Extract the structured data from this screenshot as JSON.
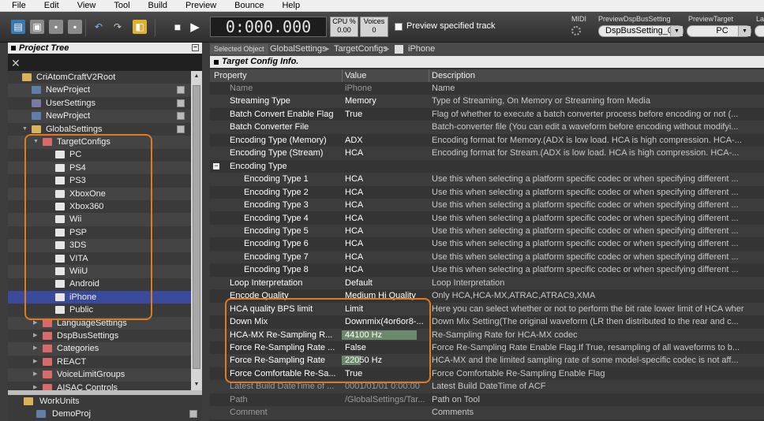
{
  "menu": [
    "File",
    "Edit",
    "View",
    "Tool",
    "Build",
    "Preview",
    "Bounce",
    "Help"
  ],
  "toolbar": {
    "timecode": "0:000.000",
    "cpu_label": "CPU %",
    "cpu_value": "0.00",
    "voices_label": "Voices",
    "voices_value": "0",
    "preview_track_label": "Preview specified track",
    "midi_label": "MIDI",
    "dspbus_label": "PreviewDspBusSetting",
    "dspbus_value": "DspBusSetting_0",
    "target_label": "PreviewTarget",
    "target_value": "PC",
    "la_label": "La"
  },
  "project_tree": {
    "title": "Project Tree",
    "items": [
      {
        "label": "CriAtomCraftV2Root",
        "icon": "folder-icon"
      },
      {
        "label": "NewProject",
        "icon": "project-icon"
      },
      {
        "label": "UserSettings",
        "icon": "settings-icon"
      },
      {
        "label": "NewProject",
        "icon": "project-icon"
      },
      {
        "label": "GlobalSettings",
        "icon": "folder-icon"
      },
      {
        "label": "TargetConfigs",
        "icon": "folder-icon"
      },
      {
        "label": "PC",
        "icon": "target-icon"
      },
      {
        "label": "PS4",
        "icon": "target-icon"
      },
      {
        "label": "PS3",
        "icon": "target-icon"
      },
      {
        "label": "XboxOne",
        "icon": "target-icon"
      },
      {
        "label": "Xbox360",
        "icon": "target-icon"
      },
      {
        "label": "Wii",
        "icon": "target-icon"
      },
      {
        "label": "PSP",
        "icon": "target-icon"
      },
      {
        "label": "3DS",
        "icon": "target-icon"
      },
      {
        "label": "VITA",
        "icon": "target-icon"
      },
      {
        "label": "WiiU",
        "icon": "target-icon"
      },
      {
        "label": "Android",
        "icon": "target-icon"
      },
      {
        "label": "iPhone",
        "icon": "target-icon"
      },
      {
        "label": "Public",
        "icon": "target-icon"
      },
      {
        "label": "LanguageSettings",
        "icon": "folder-icon"
      },
      {
        "label": "DspBusSettings",
        "icon": "folder-icon"
      },
      {
        "label": "Categories",
        "icon": "folder-icon"
      },
      {
        "label": "REACT",
        "icon": "folder-icon"
      },
      {
        "label": "VoiceLimitGroups",
        "icon": "folder-icon"
      },
      {
        "label": "AISAC Controls",
        "icon": "folder-icon"
      }
    ],
    "work_units": "WorkUnits",
    "demo_proj": "DemoProj"
  },
  "breadcrumb": {
    "selected_object": "Selected Object",
    "items": [
      "GlobalSettings",
      "TargetConfigs",
      "iPhone"
    ]
  },
  "target_config": {
    "title": "Target Config Info.",
    "columns": [
      "Property",
      "Value",
      "Description"
    ],
    "rows": [
      {
        "p": "Name",
        "v": "iPhone",
        "d": "Name"
      },
      {
        "p": "Streaming Type",
        "v": "Memory",
        "d": "Type of Streaming, On Memory or Streaming from Media"
      },
      {
        "p": "Batch Convert Enable Flag",
        "v": "True",
        "d": "Flag of whether to execute a batch converter process before encoding or not (..."
      },
      {
        "p": "Batch Converter File",
        "v": "",
        "d": "Batch-converter file (You can edit a waveform before encoding without modifyi..."
      },
      {
        "p": "Encoding Type (Memory)",
        "v": "ADX",
        "d": "Encoding format for Memory.(ADX is low load. HCA is high compression. HCA-..."
      },
      {
        "p": "Encoding Type (Stream)",
        "v": "HCA",
        "d": "Encoding format for Stream.(ADX is low load. HCA is high compression. HCA-..."
      },
      {
        "p": "Encoding Type",
        "v": "",
        "d": ""
      },
      {
        "p": "Encoding Type 1",
        "v": "HCA",
        "d": "Use this when selecting a platform specific codec or when specifying different ..."
      },
      {
        "p": "Encoding Type 2",
        "v": "HCA",
        "d": "Use this when selecting a platform specific codec or when specifying different ..."
      },
      {
        "p": "Encoding Type 3",
        "v": "HCA",
        "d": "Use this when selecting a platform specific codec or when specifying different ..."
      },
      {
        "p": "Encoding Type 4",
        "v": "HCA",
        "d": "Use this when selecting a platform specific codec or when specifying different ..."
      },
      {
        "p": "Encoding Type 5",
        "v": "HCA",
        "d": "Use this when selecting a platform specific codec or when specifying different ..."
      },
      {
        "p": "Encoding Type 6",
        "v": "HCA",
        "d": "Use this when selecting a platform specific codec or when specifying different ..."
      },
      {
        "p": "Encoding Type 7",
        "v": "HCA",
        "d": "Use this when selecting a platform specific codec or when specifying different ..."
      },
      {
        "p": "Encoding Type 8",
        "v": "HCA",
        "d": "Use this when selecting a platform specific codec or when specifying different ..."
      },
      {
        "p": "Loop Interpretation",
        "v": "Default",
        "d": "Loop Interpretation"
      },
      {
        "p": "Encode Quality",
        "v": "Medium Hi Quality",
        "d": "Only HCA,HCA-MX,ATRAC,ATRAC9,XMA"
      },
      {
        "p": "HCA quality BPS limit",
        "v": "Limit",
        "d": "Here you can select whether or not to perform the bit rate lower limit of HCA wher"
      },
      {
        "p": "Down Mix",
        "v": "Downmix(4or6or8-...",
        "d": "Down Mix Setting(The original waveform (LR then distributed to the rear and c..."
      },
      {
        "p": "HCA-MX Re-Sampling R...",
        "v": "44100 Hz",
        "d": "Re-Sampling Rate for HCA-MX codec"
      },
      {
        "p": "Force Re-Sampling Rate ...",
        "v": "False",
        "d": "Force Re-Sampling Rate Enable Flag.If True, resampling of all waveforms to b..."
      },
      {
        "p": "Force Re-Sampling Rate",
        "v": "22050 Hz",
        "d": "HCA-MX and the limited sampling rate of some model-specific codec is not aff..."
      },
      {
        "p": "Force Comfortable Re-Sa...",
        "v": "True",
        "d": "Force Comfortable Re-Sampling Enable Flag"
      },
      {
        "p": "Latest Build DateTime of ...",
        "v": "0001/01/01 0:00:00",
        "d": "Latest Build DateTime of ACF"
      },
      {
        "p": "Path",
        "v": "/GlobalSettings/Tar...",
        "d": "Path on Tool"
      },
      {
        "p": "Comment",
        "v": "",
        "d": "Comments"
      }
    ]
  },
  "colors": {
    "highlight": "#e07a1f",
    "selection": "#3a4a9a",
    "value_bar": "#6a8a6a"
  }
}
